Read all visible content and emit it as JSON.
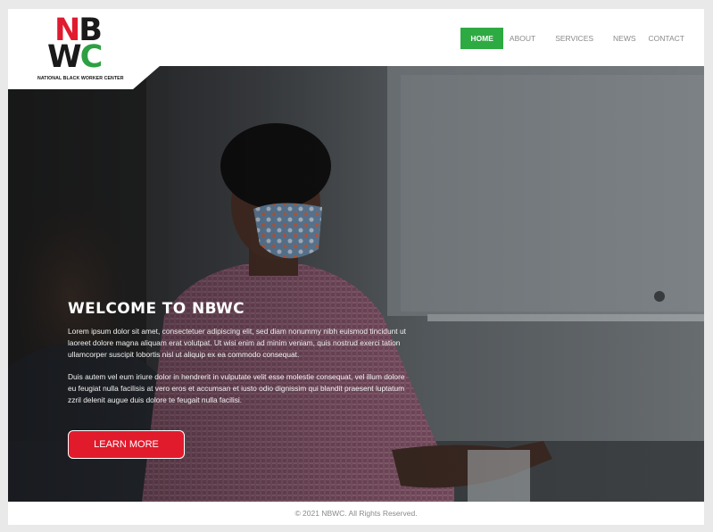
{
  "brand": {
    "logo_row1_a": "N",
    "logo_row1_b": "B",
    "logo_row2_a": "W",
    "logo_row2_b": "C",
    "tagline": "NATIONAL BLACK WORKER CENTER",
    "colors": {
      "red": "#e01b2f",
      "black": "#1a1a1a",
      "green": "#2ea043"
    }
  },
  "nav": {
    "items": [
      {
        "label": "HOME",
        "active": true
      },
      {
        "label": "ABOUT",
        "active": false
      },
      {
        "label": "SERVICES",
        "active": false
      },
      {
        "label": "NEWS",
        "active": false
      },
      {
        "label": "CONTACT",
        "active": false
      }
    ],
    "active_color": "#2eaa43"
  },
  "hero": {
    "title": "WELCOME TO NBWC",
    "paragraph1": "Lorem ipsum dolor sit amet, consectetuer adipiscing elit, sed diam nonummy nibh euismod tincidunt ut laoreet dolore magna aliquam erat volutpat. Ut wisi enim ad minim veniam, quis nostrud exerci tation ullamcorper suscipit lobortis nisl ut aliquip ex ea commodo consequat.",
    "paragraph2": "Duis autem vel eum iriure dolor in hendrerit in vulputate velit esse molestie consequat, vel illum dolore eu feugiat nulla facilisis at vero eros et accumsan et iusto odio dignissim qui blandit praesent luptatum zzril delenit augue duis dolore te feugait nulla facilisi.",
    "cta_label": "LEARN MORE",
    "cta_color": "#e11b2c"
  },
  "footer": {
    "copyright": "© 2021 NBWC. All Rights Reserved."
  }
}
